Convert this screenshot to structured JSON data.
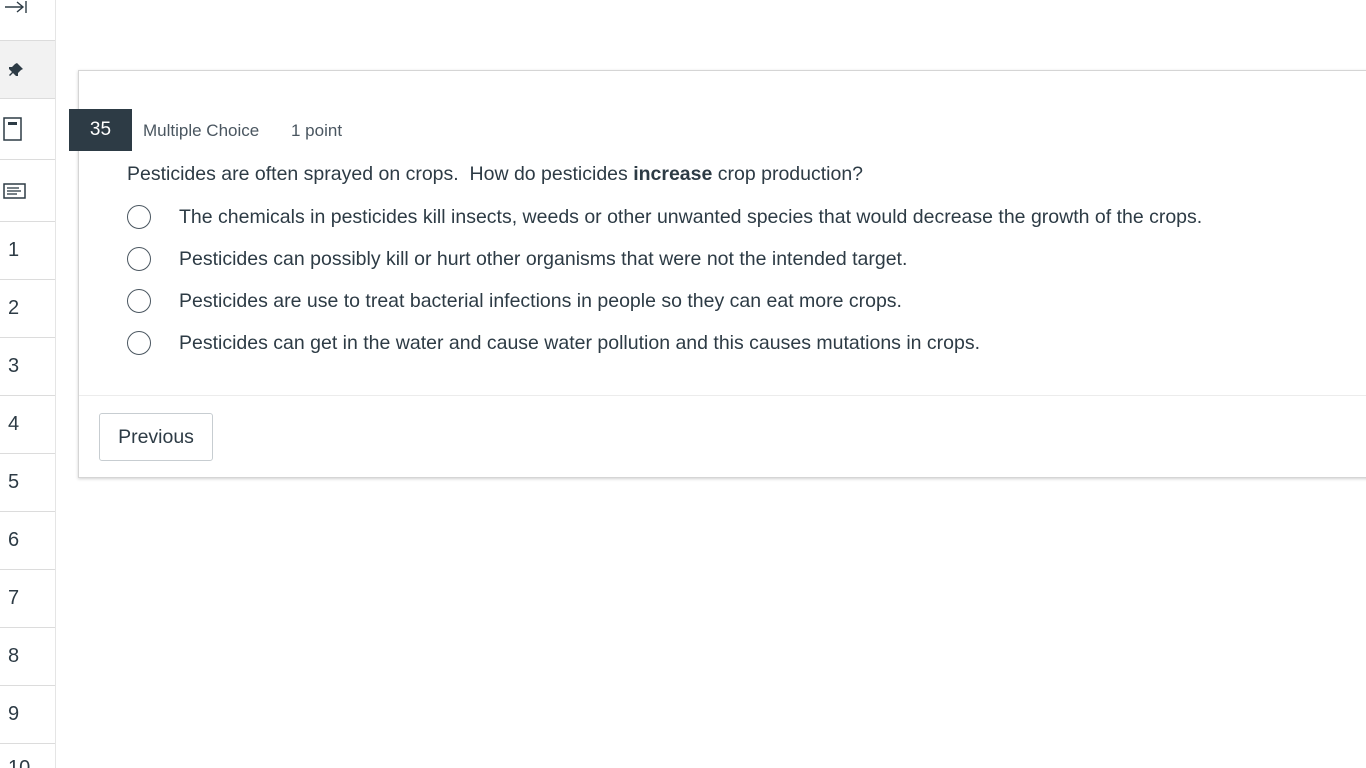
{
  "sidebar": {
    "icons": [
      "collapse-arrow-icon",
      "pin-icon",
      "bookmark-icon",
      "description-icon"
    ],
    "question_numbers": [
      "1",
      "2",
      "3",
      "4",
      "5",
      "6",
      "7",
      "8",
      "9"
    ]
  },
  "question": {
    "number": "35",
    "type": "Multiple Choice",
    "points": "1 point",
    "prompt_before": "Pesticides are often sprayed on crops.  How do pesticides ",
    "prompt_bold": "increase",
    "prompt_after": " crop production?",
    "answers": [
      "The chemicals in pesticides kill insects, weeds or other unwanted species that would decrease the growth of the crops.",
      "Pesticides can possibly kill or hurt other organisms that were not the intended target.",
      "Pesticides are use to treat bacterial infections in people so they can eat more crops.",
      "Pesticides can get in the water and cause water pollution and this causes mutations in crops."
    ]
  },
  "navigation": {
    "previous_label": "Previous"
  },
  "colors": {
    "accent_dark": "#2d3b45",
    "text": "#2d3b45",
    "muted_text": "#4a5660"
  }
}
